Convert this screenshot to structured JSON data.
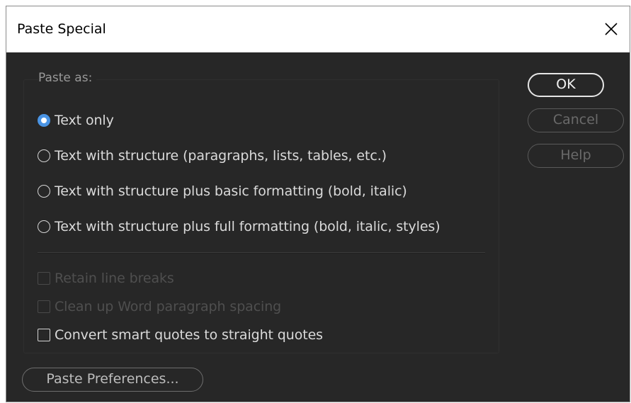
{
  "dialog": {
    "title": "Paste Special",
    "close_label": "×"
  },
  "paste_as": {
    "label": "Paste as:",
    "options": [
      {
        "label": "Text only",
        "selected": true
      },
      {
        "label": "Text with structure (paragraphs, lists, tables, etc.)",
        "selected": false
      },
      {
        "label": "Text with structure plus basic formatting (bold, italic)",
        "selected": false
      },
      {
        "label": "Text with structure plus full formatting (bold, italic, styles)",
        "selected": false
      }
    ]
  },
  "checkboxes": [
    {
      "label": "Retain line breaks",
      "checked": false,
      "enabled": false
    },
    {
      "label": "Clean up Word paragraph spacing",
      "checked": false,
      "enabled": false
    },
    {
      "label": "Convert smart quotes to straight quotes",
      "checked": false,
      "enabled": true
    }
  ],
  "buttons": {
    "ok": "OK",
    "cancel": "Cancel",
    "help": "Help",
    "preferences": "Paste Preferences..."
  },
  "colors": {
    "dialog_background": "#272727",
    "titlebar_background": "#ffffff",
    "selected_radio_accent": "#4a94e4"
  }
}
